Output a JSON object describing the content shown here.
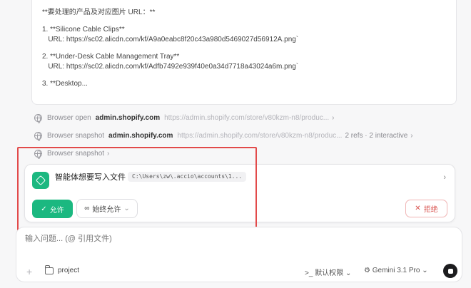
{
  "message": {
    "lines": [
      "**要处理的产品及对应图片 URL：**",
      "",
      "1. **Silicone Cable Clips**",
      "   URL: https://sc02.alicdn.com/kf/A9a0eabc8f20c43a980d5469027d56912A.png`",
      "",
      "2. **Under-Desk Cable Management Tray**",
      "   URL: https://sc02.alicdn.com/kf/Adfb7492e939f40e0a34d7718a43024a6m.png`",
      "",
      "3. **Desktop..."
    ]
  },
  "tools": [
    {
      "name": "Browser open",
      "host": "admin.shopify.com",
      "url": "https://admin.shopify.com/store/v80kzm-n8/produc...",
      "meta": ""
    },
    {
      "name": "Browser snapshot",
      "host": "admin.shopify.com",
      "url": "https://admin.shopify.com/store/v80kzm-n8/produc...",
      "meta": "2 refs · 2 interactive"
    },
    {
      "name": "Browser snapshot",
      "host": "",
      "url": "",
      "meta": ""
    }
  ],
  "permission": {
    "title": "智能体想要写入文件",
    "path": "C:\\Users\\zw\\.accio\\accounts\\1...",
    "allow_label": "允许",
    "always_label": "始终允许",
    "deny_label": "拒绝"
  },
  "composer": {
    "placeholder": "输入问题... (@ 引用文件)",
    "project": "project",
    "permission_mode": "默认权限",
    "model": "Gemini 3.1 Pro"
  },
  "colors": {
    "accent": "#1bb880",
    "highlight": "#e24a4a",
    "deny": "#d9534f"
  }
}
